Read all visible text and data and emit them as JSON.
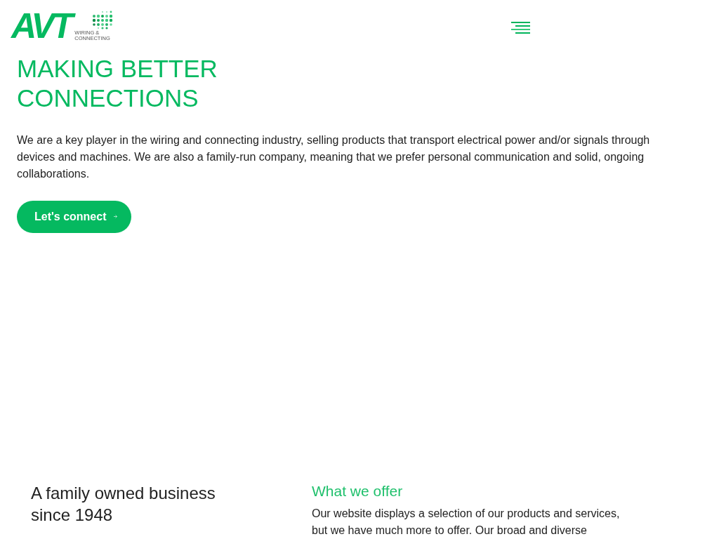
{
  "header": {
    "logo": {
      "mark": "AVT",
      "tagline": [
        "WIRING &",
        "CONNECTING"
      ]
    }
  },
  "hero": {
    "heading": "MAKING BETTER CONNECTIONS",
    "text": "We are a key player in the wiring and connecting industry, selling products that transport electrical power and/or signals through devices and machines. We are also a family-run company, meaning that we prefer personal communication and solid, ongoing collaborations.",
    "button": {
      "label": "Let's connect"
    }
  },
  "about": {
    "heading": "A family owned business since 1948"
  },
  "offer": {
    "heading": "What we offer",
    "text": "Our website displays a selection of our products and services, but we have much more to offer. Our broad and diverse"
  }
}
